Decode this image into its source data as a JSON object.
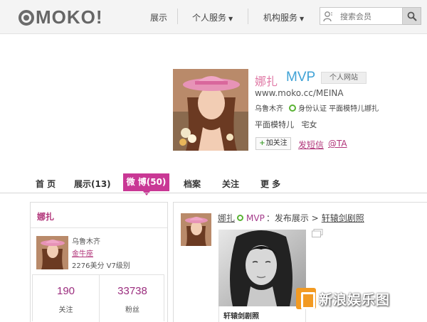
{
  "header": {
    "logo_text": "MOKO!",
    "nav": [
      {
        "label": "展示"
      },
      {
        "label": "个人服务"
      },
      {
        "label": "机构服务"
      }
    ],
    "search": {
      "placeholder": "搜索会员"
    }
  },
  "profile": {
    "name": "娜扎",
    "badge": "MVP",
    "site_button": "个人网站",
    "url": "www.moko.cc/MEINA",
    "location": "乌鲁木齐",
    "verification": "身份认证 平面模特儿娜扎",
    "tags": "平面模特儿   宅女",
    "follow_button": "加关注",
    "message_link": "发短信",
    "at_link": "@TA"
  },
  "tabs": [
    {
      "label": "首 页"
    },
    {
      "label": "展示(13)"
    },
    {
      "label": "微 博(50)",
      "active": true
    },
    {
      "label": "档案"
    },
    {
      "label": "关注"
    },
    {
      "label": "更 多"
    }
  ],
  "sidebar": {
    "name": "娜扎",
    "city": "乌鲁木齐",
    "zodiac": "金牛座",
    "score": "2276美分",
    "level": "V7级别",
    "stats": [
      {
        "value": "190",
        "label": "关注"
      },
      {
        "value": "33738",
        "label": "粉丝"
      }
    ]
  },
  "feed": {
    "author": "娜扎",
    "badge": "MVP",
    "action": "：发布展示 >",
    "album": "轩辕剑剧照",
    "photo_caption": "轩辕剑剧照"
  },
  "watermark": {
    "text": "新浪娱乐图"
  },
  "colors": {
    "accent": "#c93895",
    "name_pink": "#e07aa6",
    "mvp_blue": "#3fa2d6",
    "verified_green": "#59b233"
  }
}
